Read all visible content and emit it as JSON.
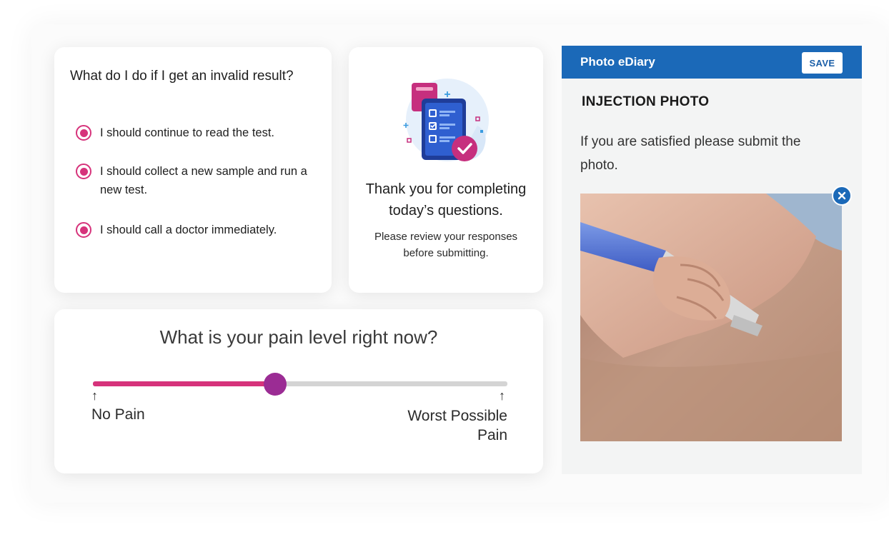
{
  "quiz": {
    "question": "What do I do if I get an invalid result?",
    "options": [
      {
        "label": "I should continue to read the test.",
        "selected": true
      },
      {
        "label": "I should collect a new sample and run a new test.",
        "selected": true
      },
      {
        "label": "I should call a doctor immediately.",
        "selected": true
      }
    ]
  },
  "completion": {
    "icon": "checklist-phone-icon",
    "title": "Thank you for completing today’s questions.",
    "subtitle": "Please review your responses before submitting."
  },
  "pain_scale": {
    "question": "What is your pain level right now?",
    "value_fraction": 0.44,
    "min_label": "No Pain",
    "max_label": "Worst Possible Pain"
  },
  "ediary": {
    "title": "Photo eDiary",
    "save_label": "SAVE",
    "section_title": "INJECTION PHOTO",
    "instructions": "If you are satisfied please submit the photo.",
    "photo_subject": "injection pen being pressed against skin"
  },
  "colors": {
    "accent_pink": "#d6337b",
    "slider_thumb": "#9b2c94",
    "header_blue": "#1b69b8",
    "panel_bg": "#f3f4f4"
  }
}
